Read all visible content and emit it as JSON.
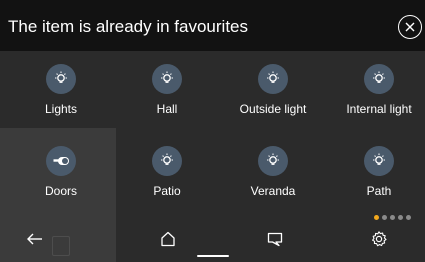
{
  "toast": {
    "message": "The item is already in favourites",
    "close_icon": "close-circle-icon"
  },
  "tiles": [
    {
      "label": "Lights",
      "icon": "bulb-icon"
    },
    {
      "label": "Hall",
      "icon": "bulb-icon"
    },
    {
      "label": "Outside light",
      "icon": "bulb-icon"
    },
    {
      "label": "Internal light",
      "icon": "bulb-icon"
    },
    {
      "label": "Doors",
      "icon": "key-toggle-icon"
    },
    {
      "label": "Patio",
      "icon": "bulb-icon"
    },
    {
      "label": "Veranda",
      "icon": "bulb-icon"
    },
    {
      "label": "Path",
      "icon": "bulb-icon"
    }
  ],
  "pager": {
    "pages": 5,
    "current": 1
  },
  "nav": {
    "back_icon": "back-arrow-icon",
    "home_icon": "home-icon",
    "chat_icon": "chat-bubble-icon",
    "settings_icon": "gear-icon"
  },
  "colors": {
    "icon_circle": "#4a5a6b",
    "pager_active": "#f2a81d",
    "toast_bg": "#121212"
  }
}
